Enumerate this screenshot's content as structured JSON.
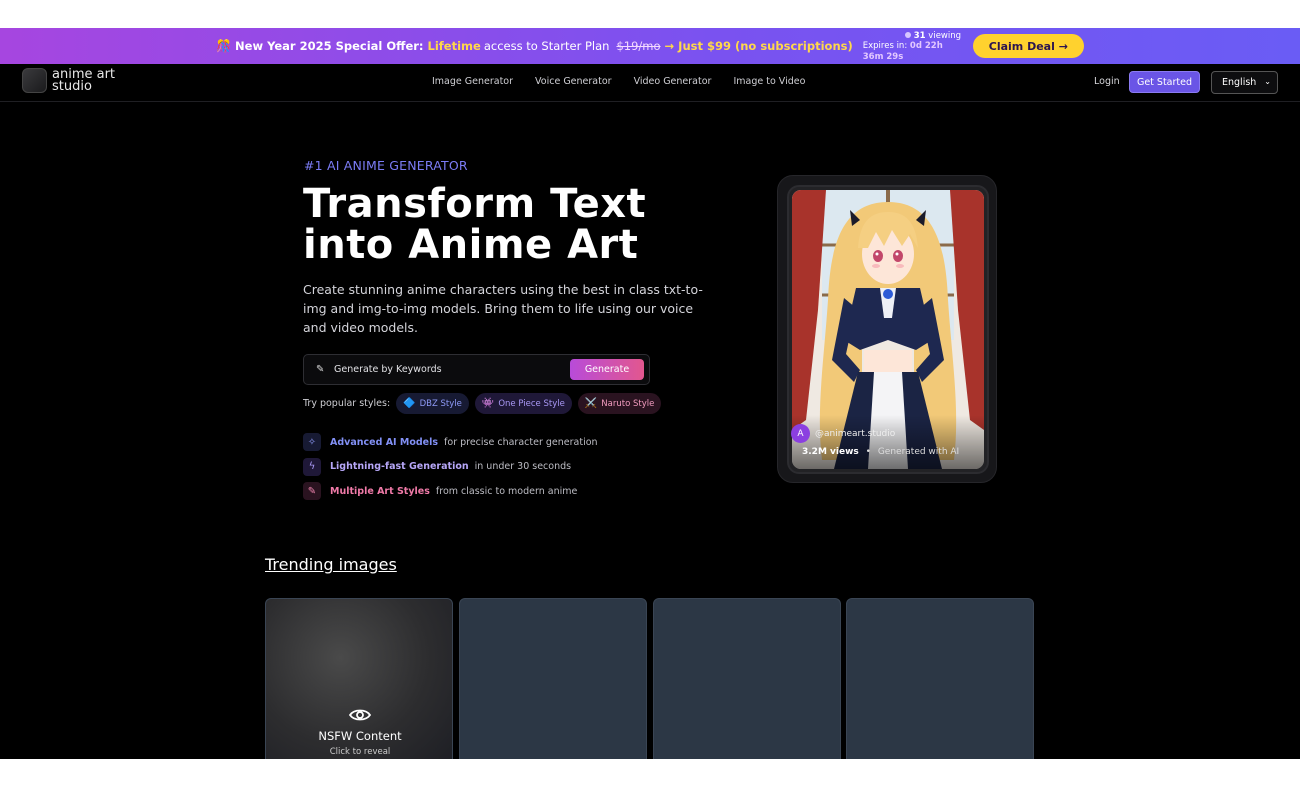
{
  "promo": {
    "party_icon": "🎊",
    "title": "New Year 2025 Special Offer:",
    "lifetime": "Lifetime",
    "access_text": "access to Starter Plan",
    "old_price": "$19/mo",
    "deal": "→ Just $99 (no subscriptions)",
    "viewing_count": "31",
    "viewing_label": "viewing",
    "expires_label": "Expires in:",
    "expires_time": "0d 22h 36m 29s",
    "claim_label": "Claim Deal →"
  },
  "nav": {
    "brand_line1": "anime art",
    "brand_line2": "studio",
    "links": [
      "Image Generator",
      "Voice Generator",
      "Video Generator",
      "Image to Video"
    ],
    "login": "Login",
    "get_started": "Get Started",
    "language": "English"
  },
  "hero": {
    "eyebrow": "#1 AI ANIME GENERATOR",
    "headline_line1": "Transform Text",
    "headline_line2": "into Anime Art",
    "subtitle": "Create stunning anime characters using the best in class txt-to-img and img-to-img models. Bring them to life using our voice and video models.",
    "input_placeholder": "Generate by Keywords",
    "generate_label": "Generate",
    "popular_label": "Try popular styles:",
    "styles": [
      {
        "icon": "🔷",
        "label": "DBZ Style"
      },
      {
        "icon": "👾",
        "label": "One Piece Style"
      },
      {
        "icon": "⚔️",
        "label": "Naruto Style"
      }
    ],
    "features": [
      {
        "icon": "sparkles-icon",
        "title": "Advanced AI Models",
        "desc": "for precise character generation"
      },
      {
        "icon": "lightning-icon",
        "title": "Lightning-fast Generation",
        "desc": "in under 30 seconds"
      },
      {
        "icon": "brush-icon",
        "title": "Multiple Art Styles",
        "desc": "from classic to modern anime"
      }
    ]
  },
  "preview": {
    "avatar_letter": "A",
    "handle": "@animeart.studio",
    "views": "3.2M views",
    "separator": "•",
    "generated": "Generated with AI"
  },
  "trending": {
    "title": "Trending images",
    "nsfw_title": "NSFW Content",
    "nsfw_sub": "Click to reveal"
  },
  "colors": {
    "accent": "#6a55e6",
    "claim": "#ffd22e",
    "generate_start": "#b84bd9",
    "generate_end": "#e2578e"
  }
}
